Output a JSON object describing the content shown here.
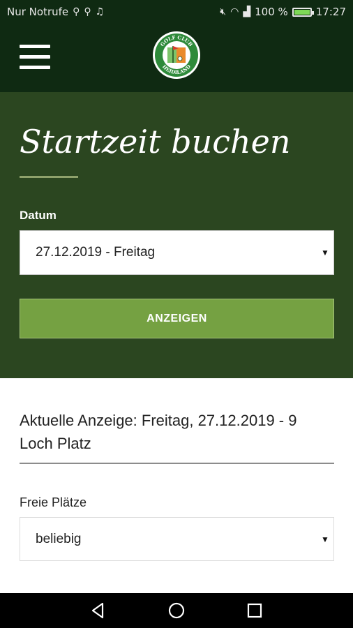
{
  "statusbar": {
    "carrier": "Nur Notrufe",
    "battery_text": "100 %",
    "time": "17:27",
    "battery_level": 1.0
  },
  "appbar": {
    "logo_top_text": "GOLF CLUB",
    "logo_bottom_text": "HEIDILAND"
  },
  "hero": {
    "title": "Startzeit buchen",
    "date_label": "Datum",
    "date_value": "27.12.2019 - Freitag",
    "show_button": "ANZEIGEN"
  },
  "results": {
    "heading": "Aktuelle Anzeige: Freitag, 27.12.2019 - 9 Loch Platz",
    "seats_label": "Freie Plätze",
    "seats_value": "beliebig"
  },
  "colors": {
    "appbar_bg": "#0f2a12",
    "hero_bg": "#2b4620",
    "button_bg": "#75a142"
  }
}
